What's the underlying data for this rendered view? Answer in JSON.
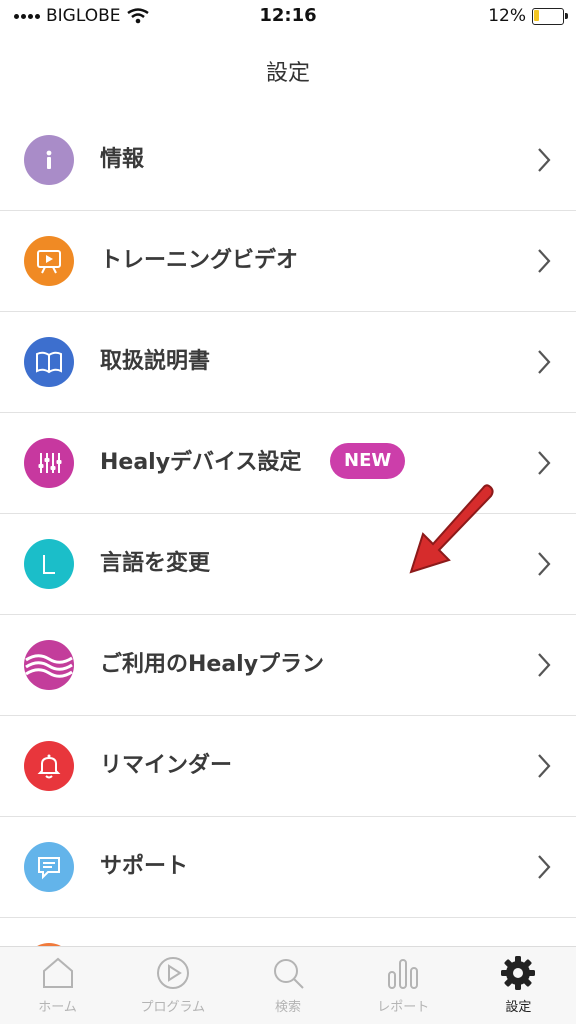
{
  "status_bar": {
    "carrier": "BIGLOBE",
    "time": "12:16",
    "battery": "12%"
  },
  "header": {
    "title": "設定"
  },
  "menu": [
    {
      "label": "情報",
      "color": "#a98cc8",
      "icon": "info-icon"
    },
    {
      "label": "トレーニングビデオ",
      "color": "#f08a24",
      "icon": "video-presentation-icon"
    },
    {
      "label": "取扱説明書",
      "color": "#3d6fce",
      "icon": "book-icon"
    },
    {
      "label": "Healyデバイス設定",
      "color": "#c7389f",
      "icon": "sliders-icon",
      "badge": "NEW"
    },
    {
      "label": "言語を変更",
      "color": "#1bbec9",
      "icon": "language-icon"
    },
    {
      "label": "ご利用のHealyプラン",
      "color": "#c33d9b",
      "icon": "waves-icon"
    },
    {
      "label": "リマインダー",
      "color": "#e8363c",
      "icon": "bell-icon"
    },
    {
      "label": "サポート",
      "color": "#63b4ea",
      "icon": "chat-icon"
    }
  ],
  "tabs": [
    {
      "label": "ホーム",
      "icon": "home-icon"
    },
    {
      "label": "プログラム",
      "icon": "play-icon"
    },
    {
      "label": "検索",
      "icon": "search-icon"
    },
    {
      "label": "レポート",
      "icon": "chart-icon"
    },
    {
      "label": "設定",
      "icon": "gear-icon",
      "active": true
    }
  ]
}
